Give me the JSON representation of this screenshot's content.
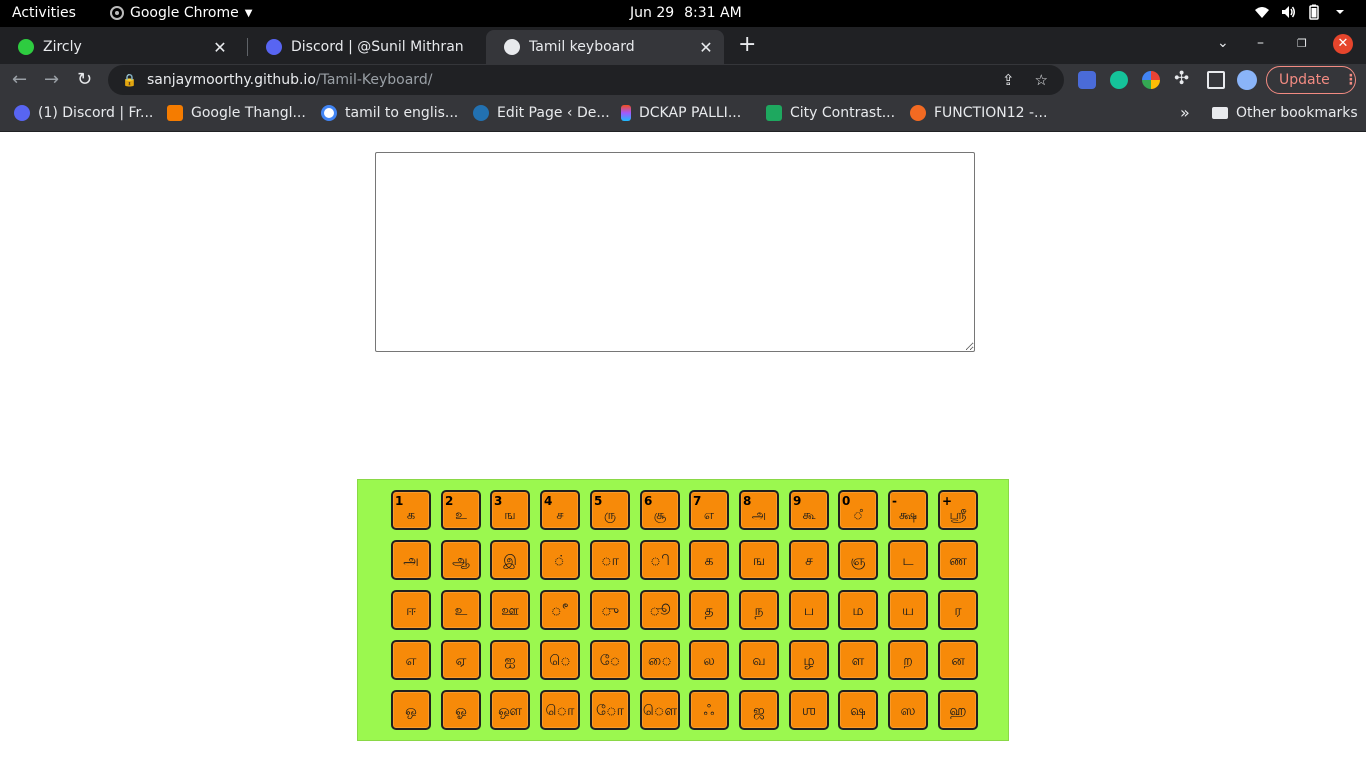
{
  "system_bar": {
    "activities": "Activities",
    "app_name": "Google Chrome",
    "date": "Jun 29",
    "time": "8:31 AM"
  },
  "browser": {
    "tabs": [
      {
        "title": "Zircly",
        "favicon_color": "#2ecc40",
        "active": false
      },
      {
        "title": "Discord | @Sunil Mithran",
        "favicon_color": "#5865f2",
        "active": false
      },
      {
        "title": "Tamil keyboard",
        "favicon_color": "#e8eaed",
        "active": true
      }
    ],
    "url_host": "sanjaymoorthy.github.io",
    "url_path": "/Tamil-Keyboard/",
    "update_label": "Update",
    "bookmarks": [
      {
        "label": "(1) Discord | Fr...",
        "color": "#5865f2"
      },
      {
        "label": "Google Thangl...",
        "color": "#f57c00"
      },
      {
        "label": "tamil to englis...",
        "color": "#ffffff"
      },
      {
        "label": "Edit Page ‹ De...",
        "color": "#2271b1"
      },
      {
        "label": "DCKAP PALLI...",
        "color": "#a259ff"
      },
      {
        "label": "City Contrast...",
        "color": "#1ea85f"
      },
      {
        "label": "FUNCTION12 -...",
        "color": "#f26a22"
      }
    ],
    "other_bookmarks": "Other bookmarks"
  },
  "editor": {
    "value": ""
  },
  "keyboard": {
    "key_color": "#f78a09",
    "background_color": "#9bf84f",
    "rows": [
      [
        {
          "num": "1",
          "glyph": "க"
        },
        {
          "num": "2",
          "glyph": "உ"
        },
        {
          "num": "3",
          "glyph": "ங"
        },
        {
          "num": "4",
          "glyph": "ச"
        },
        {
          "num": "5",
          "glyph": "ரு"
        },
        {
          "num": "6",
          "glyph": "சூ"
        },
        {
          "num": "7",
          "glyph": "எ"
        },
        {
          "num": "8",
          "glyph": "அ"
        },
        {
          "num": "9",
          "glyph": "கூ"
        },
        {
          "num": "0",
          "glyph": "ஂ"
        },
        {
          "num": "-",
          "glyph": "க்ஷ"
        },
        {
          "num": "+",
          "glyph": "ஸ்ரீ"
        }
      ],
      [
        {
          "num": "",
          "glyph": "அ"
        },
        {
          "num": "",
          "glyph": "ஆ"
        },
        {
          "num": "",
          "glyph": "இ"
        },
        {
          "num": "",
          "glyph": "◌்"
        },
        {
          "num": "",
          "glyph": "◌ா"
        },
        {
          "num": "",
          "glyph": "◌ி"
        },
        {
          "num": "",
          "glyph": "க"
        },
        {
          "num": "",
          "glyph": "ங"
        },
        {
          "num": "",
          "glyph": "ச"
        },
        {
          "num": "",
          "glyph": "ஞ"
        },
        {
          "num": "",
          "glyph": "ட"
        },
        {
          "num": "",
          "glyph": "ண"
        }
      ],
      [
        {
          "num": "",
          "glyph": "ஈ"
        },
        {
          "num": "",
          "glyph": "உ"
        },
        {
          "num": "",
          "glyph": "ஊ"
        },
        {
          "num": "",
          "glyph": "◌ீ"
        },
        {
          "num": "",
          "glyph": "◌ு"
        },
        {
          "num": "",
          "glyph": "◌ூ"
        },
        {
          "num": "",
          "glyph": "த"
        },
        {
          "num": "",
          "glyph": "ந"
        },
        {
          "num": "",
          "glyph": "ப"
        },
        {
          "num": "",
          "glyph": "ம"
        },
        {
          "num": "",
          "glyph": "ய"
        },
        {
          "num": "",
          "glyph": "ர"
        }
      ],
      [
        {
          "num": "",
          "glyph": "எ"
        },
        {
          "num": "",
          "glyph": "ஏ"
        },
        {
          "num": "",
          "glyph": "ஐ"
        },
        {
          "num": "",
          "glyph": "◌ெ"
        },
        {
          "num": "",
          "glyph": "◌ே"
        },
        {
          "num": "",
          "glyph": "◌ை"
        },
        {
          "num": "",
          "glyph": "ல"
        },
        {
          "num": "",
          "glyph": "வ"
        },
        {
          "num": "",
          "glyph": "ழ"
        },
        {
          "num": "",
          "glyph": "ள"
        },
        {
          "num": "",
          "glyph": "ற"
        },
        {
          "num": "",
          "glyph": "ன"
        }
      ],
      [
        {
          "num": "",
          "glyph": "ஒ"
        },
        {
          "num": "",
          "glyph": "ஓ"
        },
        {
          "num": "",
          "glyph": "ஔ"
        },
        {
          "num": "",
          "glyph": "◌ொ"
        },
        {
          "num": "",
          "glyph": "◌ோ"
        },
        {
          "num": "",
          "glyph": "◌ௌ"
        },
        {
          "num": "",
          "glyph": "ஃ"
        },
        {
          "num": "",
          "glyph": "ஜ"
        },
        {
          "num": "",
          "glyph": "ஶ"
        },
        {
          "num": "",
          "glyph": "ஷ"
        },
        {
          "num": "",
          "glyph": "ஸ"
        },
        {
          "num": "",
          "glyph": "ஹ"
        }
      ]
    ]
  }
}
